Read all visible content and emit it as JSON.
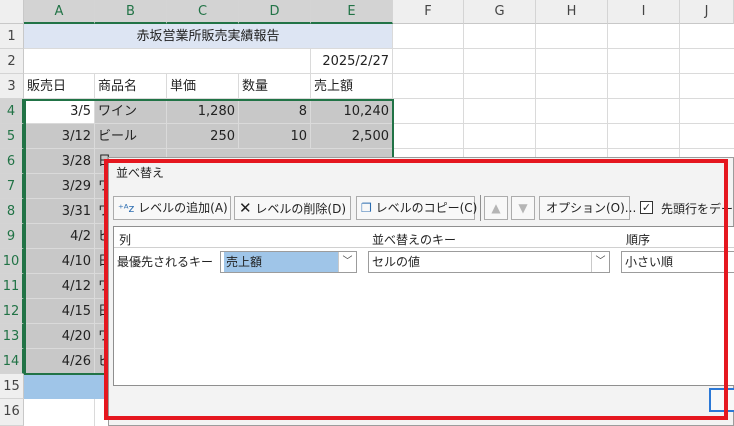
{
  "columns": [
    "A",
    "B",
    "C",
    "D",
    "E",
    "F",
    "G",
    "H",
    "I",
    "J"
  ],
  "rows": [
    "1",
    "2",
    "3",
    "4",
    "5",
    "6",
    "7",
    "8",
    "9",
    "10",
    "11",
    "12",
    "13",
    "14",
    "15",
    "16"
  ],
  "sheet": {
    "title": "赤坂営業所販売実績報告",
    "date": "2025/2/27",
    "headers": [
      "販売日",
      "商品名",
      "単価",
      "数量",
      "売上額"
    ],
    "data": [
      {
        "date": "3/5",
        "product": "ワイン",
        "price": "1,280",
        "qty": "8",
        "sales": "10,240"
      },
      {
        "date": "3/12",
        "product": "ビール",
        "price": "250",
        "qty": "10",
        "sales": "2,500"
      },
      {
        "date": "3/28",
        "product": "日",
        "price": "",
        "qty": "",
        "sales": ""
      },
      {
        "date": "3/29",
        "product": "ワ",
        "price": "",
        "qty": "",
        "sales": ""
      },
      {
        "date": "3/31",
        "product": "ワ",
        "price": "",
        "qty": "",
        "sales": ""
      },
      {
        "date": "4/2",
        "product": "ビ",
        "price": "",
        "qty": "",
        "sales": ""
      },
      {
        "date": "4/10",
        "product": "日",
        "price": "",
        "qty": "",
        "sales": ""
      },
      {
        "date": "4/12",
        "product": "ワ",
        "price": "",
        "qty": "",
        "sales": ""
      },
      {
        "date": "4/15",
        "product": "日",
        "price": "",
        "qty": "",
        "sales": ""
      },
      {
        "date": "4/20",
        "product": "ワ",
        "price": "",
        "qty": "",
        "sales": ""
      },
      {
        "date": "4/26",
        "product": "ビ",
        "price": "",
        "qty": "",
        "sales": ""
      }
    ]
  },
  "dialog": {
    "title": "並べ替え",
    "add_level": "レベルの追加(A)",
    "delete_level": "レベルの削除(D)",
    "copy_level": "レベルのコピー(C)",
    "options": "オプション(O)...",
    "header_checkbox": "先頭行をデータ",
    "header_checked": true,
    "col_header_column": "列",
    "col_header_key": "並べ替えのキー",
    "col_header_order": "順序",
    "row_label": "最優先されるキー",
    "sort_column": "売上額",
    "sort_on": "セルの値",
    "sort_order": "小さい順"
  },
  "colors": {
    "highlight": "#e5171f",
    "excel_green": "#217346",
    "selection_blue": "#9fc5e8"
  },
  "icons": [
    "add-level-icon",
    "delete-x-icon",
    "copy-icon",
    "up-arrow-icon",
    "down-arrow-icon",
    "checkbox-icon",
    "dropdown-arrow-icon"
  ]
}
